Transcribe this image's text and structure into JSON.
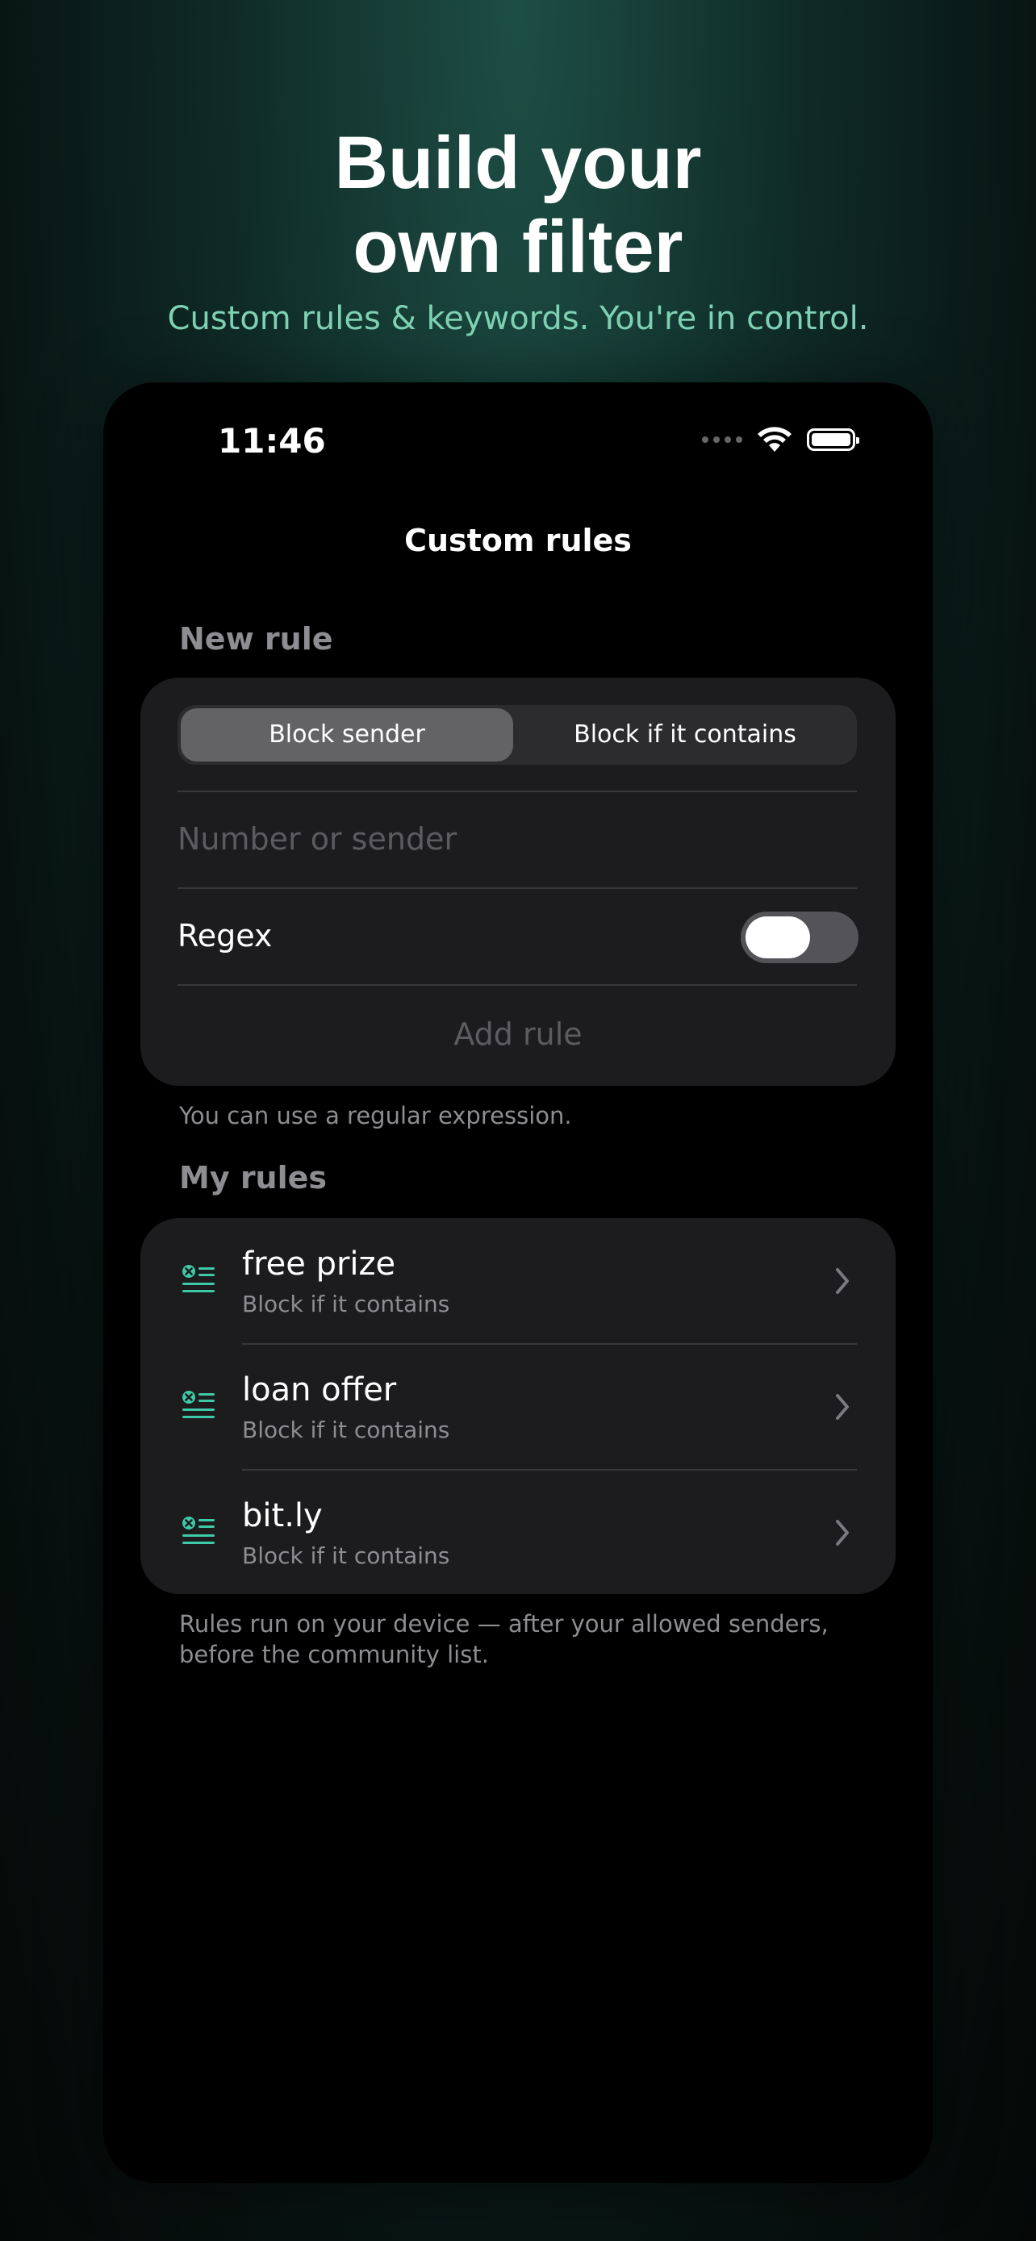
{
  "hero": {
    "title_line1": "Build your",
    "title_line2": "own filter",
    "subtitle": "Custom rules & keywords. You're in control."
  },
  "status_bar": {
    "time": "11:46"
  },
  "nav": {
    "title": "Custom rules"
  },
  "new_rule": {
    "header": "New rule",
    "segments": [
      "Block sender",
      "Block if it contains"
    ],
    "selected_segment": "Block sender",
    "input_placeholder": "Number or sender",
    "input_value": "",
    "regex_label": "Regex",
    "regex_enabled": false,
    "add_button": "Add rule",
    "footnote": "You can use a regular expression."
  },
  "my_rules": {
    "header": "My rules",
    "items": [
      {
        "title": "free prize",
        "subtitle": "Block if it contains"
      },
      {
        "title": "loan offer",
        "subtitle": "Block if it contains"
      },
      {
        "title": "bit.ly",
        "subtitle": "Block if it contains"
      }
    ],
    "footnote": "Rules run on your device — after your allowed senders, before the community list."
  },
  "colors": {
    "accent": "#3ec9a7",
    "subtitle_green": "#7fd3b4",
    "card_bg": "#1c1c1e",
    "secondary_text": "#8d8d92"
  },
  "icons": {
    "wifi": "wifi-icon",
    "battery": "battery-icon",
    "rule": "blocked-list-icon",
    "chevron": "chevron-right-icon"
  }
}
